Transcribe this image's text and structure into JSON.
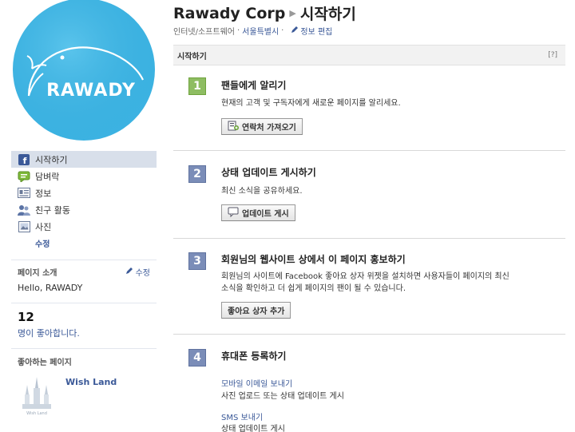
{
  "profile": {
    "logo_text": "RAWADY",
    "logo_color": "#3cb3e2"
  },
  "nav": {
    "items": [
      {
        "label": "시작하기",
        "icon": "facebook-icon"
      },
      {
        "label": "담벼락",
        "icon": "wall-icon"
      },
      {
        "label": "정보",
        "icon": "info-card-icon"
      },
      {
        "label": "친구 활동",
        "icon": "friends-icon"
      },
      {
        "label": "사진",
        "icon": "photos-icon"
      }
    ],
    "edit_label": "수정"
  },
  "about": {
    "heading": "페이지 소개",
    "edit_label": "수정",
    "text": "Hello, RAWADY"
  },
  "likes": {
    "count": "12",
    "label": "명이 좋아합니다."
  },
  "liked_pages": {
    "heading": "좋아하는 페이지",
    "items": [
      {
        "name": "Wish Land"
      }
    ]
  },
  "header": {
    "page_name": "Rawady Corp",
    "section": "시작하기",
    "category": "인터넷/소프트웨어",
    "sep": "·",
    "location": "서울특별시",
    "sep2": "·",
    "edit_info": "정보 편집"
  },
  "panel": {
    "title": "시작하기",
    "help": "[?]",
    "steps": [
      {
        "num": "1",
        "title": "팬들에게 알리기",
        "desc": "현재의 고객 및 구독자에게 새로운 페이지를 알리세요.",
        "button": "연락처 가져오기"
      },
      {
        "num": "2",
        "title": "상태 업데이트 게시하기",
        "desc": "최신 소식을 공유하세요.",
        "button": "업데이트 게시"
      },
      {
        "num": "3",
        "title": "회원님의 웹사이트 상에서 이 페이지 홍보하기",
        "desc1": "회원님의 사이트에 Facebook 좋아요 상자 위젯을 설치하면 사용자들이 페이지의 최신",
        "desc2": "소식을 확인하고 더 쉽게 페이지의 팬이 될 수 있습니다.",
        "button": "좋아요 상자 추가"
      },
      {
        "num": "4",
        "title": "휴대폰 등록하기",
        "link1": "모바일 이메일 보내기",
        "text1": "사진 업로드 또는 상태 업데이트 게시",
        "link2": "SMS 보내기",
        "text2": "상태 업데이트 게시"
      }
    ]
  }
}
